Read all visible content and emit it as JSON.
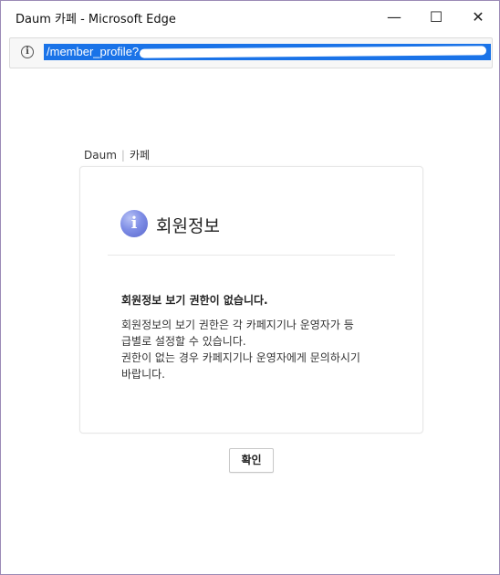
{
  "window": {
    "title": "Daum 카페 - Microsoft Edge",
    "controls": {
      "minimize_glyph": "—",
      "maximize_glyph": "☐",
      "close_glyph": "✕"
    }
  },
  "address_bar": {
    "url_visible": "/member_profile?",
    "info_icon": "i"
  },
  "page": {
    "logo_daum": "Daum",
    "logo_separator": "|",
    "logo_cafe": "카페"
  },
  "card": {
    "icon_glyph": "i",
    "title": "회원정보",
    "heading": "회원정보 보기 권한이 없습니다.",
    "body_lines": [
      "회원정보의 보기 권한은 각 카페지기나 운영자가 등",
      "급별로 설정할 수 있습니다.",
      "권한이 없는 경우 카페지기나 운영자에게 문의하시기",
      "바랍니다."
    ]
  },
  "actions": {
    "confirm_label": "확인"
  },
  "colors": {
    "url_highlight": "#1a73e8",
    "icon_blue": "#7f8ee6",
    "window_border": "#9b8ab6"
  }
}
